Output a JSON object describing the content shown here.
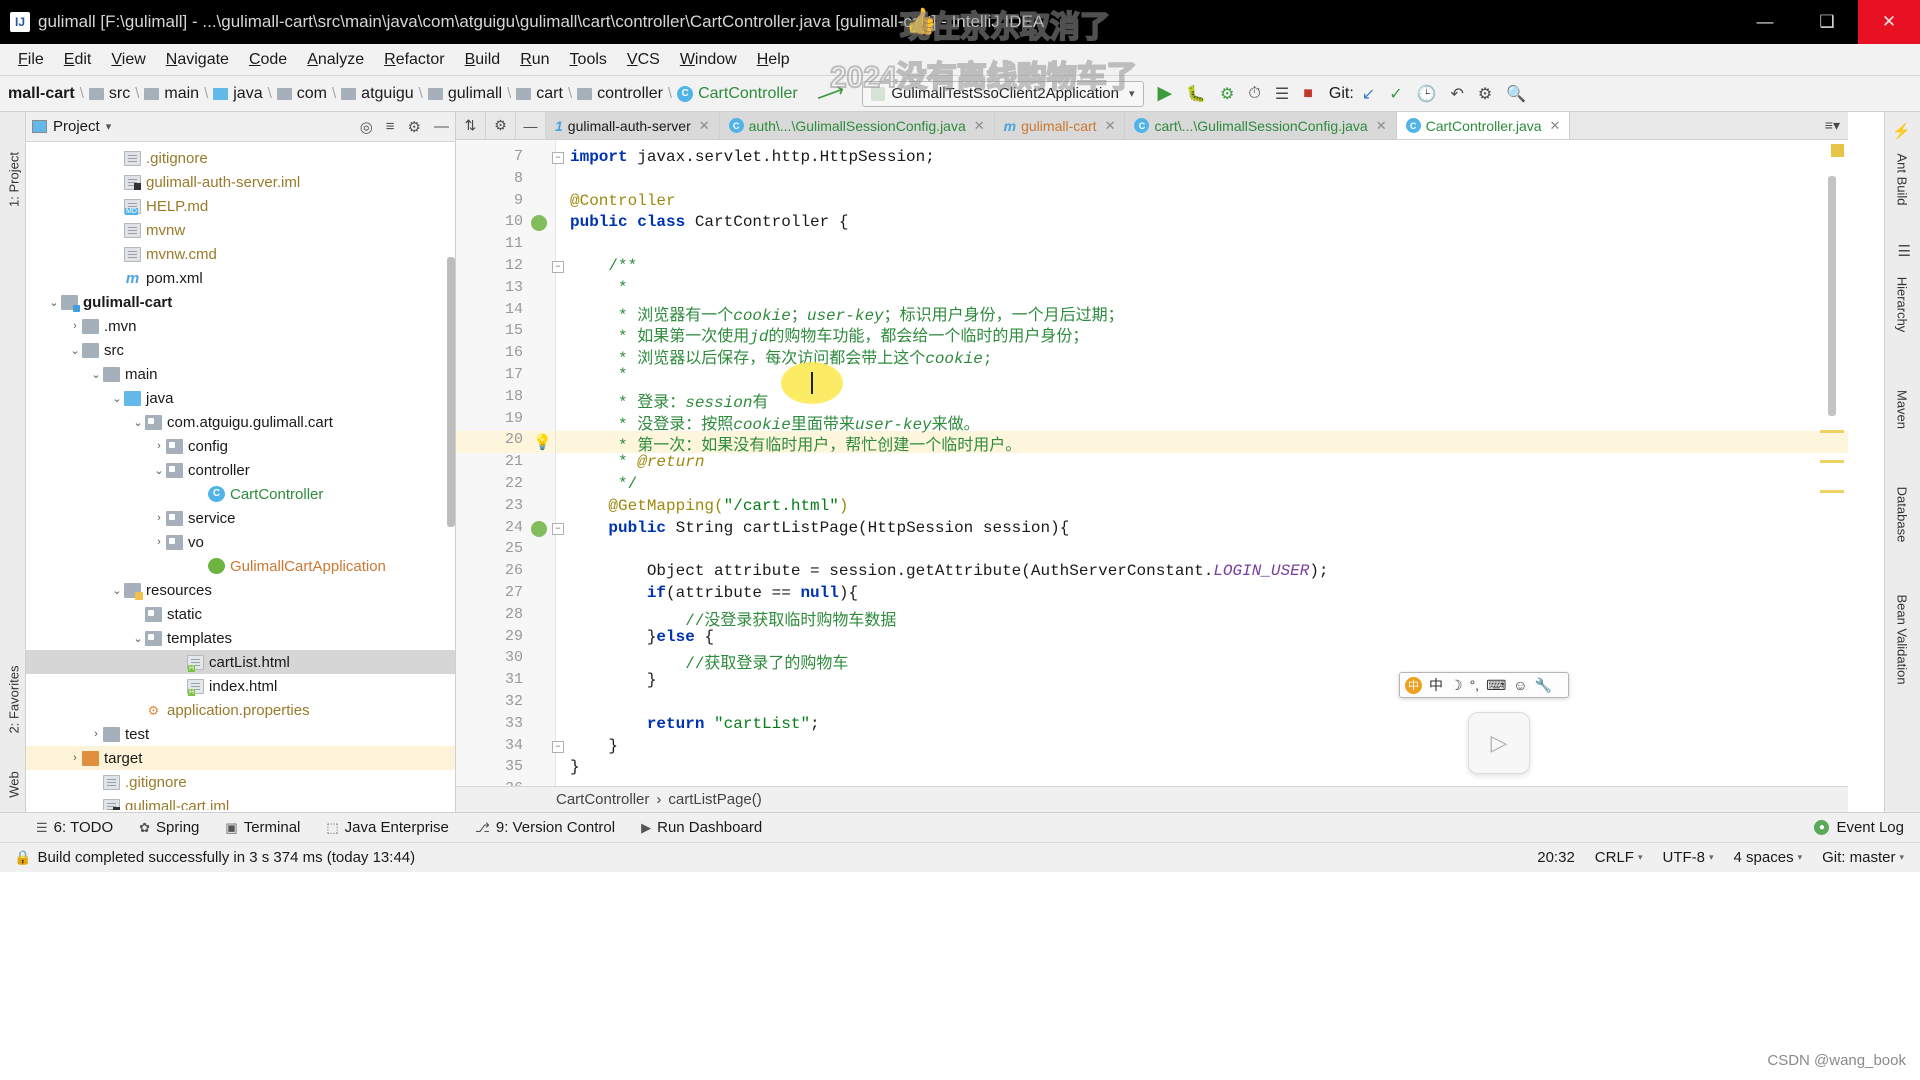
{
  "window": {
    "title": "gulimall [F:\\gulimall] - ...\\gulimall-cart\\src\\main\\java\\com\\atguigu\\gulimall\\cart\\controller\\CartController.java [gulimall-cart] - IntelliJ IDEA",
    "app_icon": "intellij-idea-icon",
    "minimize": "—",
    "maximize": "❑",
    "close": "✕"
  },
  "watermark": {
    "line1": "现在京东取消了",
    "line2": "2024没有离线购物车了",
    "thumb": "👍",
    "credit": "CSDN @wang_book"
  },
  "menubar": [
    "File",
    "Edit",
    "View",
    "Navigate",
    "Code",
    "Analyze",
    "Refactor",
    "Build",
    "Run",
    "Tools",
    "VCS",
    "Window",
    "Help"
  ],
  "breadcrumb": [
    {
      "label": "mall-cart",
      "icon": "module-icon",
      "bold": true
    },
    {
      "label": "src",
      "icon": "folder-icon"
    },
    {
      "label": "main",
      "icon": "folder-icon"
    },
    {
      "label": "java",
      "icon": "source-folder-icon"
    },
    {
      "label": "com",
      "icon": "folder-icon"
    },
    {
      "label": "atguigu",
      "icon": "folder-icon"
    },
    {
      "label": "gulimall",
      "icon": "folder-icon"
    },
    {
      "label": "cart",
      "icon": "folder-icon"
    },
    {
      "label": "controller",
      "icon": "folder-icon"
    },
    {
      "label": "CartController",
      "icon": "class-icon"
    }
  ],
  "toolbar": {
    "back_arrow_icon": "back-arrow-icon",
    "run_config": "GulimallTestSsoClient2Application",
    "run_config_caret": "▾",
    "icons": [
      "run-icon",
      "debug-icon",
      "run-with-coverage-icon",
      "profiler-icon",
      "build-icon",
      "stop-icon"
    ],
    "git_label": "Git:",
    "git_icons": [
      "update-project-icon",
      "commit-icon",
      "history-icon",
      "rollback-icon",
      "settings-icon",
      "search-everywhere-icon"
    ]
  },
  "left_strip": [
    "1: Project",
    "2: Favorites",
    "Web"
  ],
  "project_panel": {
    "title": "Project",
    "title_caret": "▾",
    "header_icons": [
      "locate-icon",
      "collapse-all-icon",
      "settings-icon",
      "hide-icon"
    ],
    "tree": [
      {
        "indent": 4,
        "arrow": "",
        "icon": "file-icon",
        "label": ".gitignore",
        "style": "amberTxt"
      },
      {
        "indent": 4,
        "arrow": "",
        "icon": "iml-file-icon",
        "label": "gulimall-auth-server.iml",
        "style": "amberTxt"
      },
      {
        "indent": 4,
        "arrow": "",
        "icon": "markdown-file-icon",
        "label": "HELP.md",
        "style": "amberTxt"
      },
      {
        "indent": 4,
        "arrow": "",
        "icon": "file-icon",
        "label": "mvnw",
        "style": "amberTxt"
      },
      {
        "indent": 4,
        "arrow": "",
        "icon": "file-icon",
        "label": "mvnw.cmd",
        "style": "amberTxt"
      },
      {
        "indent": 4,
        "arrow": "",
        "icon": "maven-file-icon",
        "label": "pom.xml",
        "style": "plain"
      },
      {
        "indent": 1,
        "arrow": "⌄",
        "icon": "module-folder-icon",
        "label": "gulimall-cart",
        "style": "bold"
      },
      {
        "indent": 2,
        "arrow": "›",
        "icon": "folder-icon",
        "label": ".mvn",
        "style": "plain"
      },
      {
        "indent": 2,
        "arrow": "⌄",
        "icon": "folder-icon",
        "label": "src",
        "style": "plain"
      },
      {
        "indent": 3,
        "arrow": "⌄",
        "icon": "folder-icon",
        "label": "main",
        "style": "plain"
      },
      {
        "indent": 4,
        "arrow": "⌄",
        "icon": "source-folder-icon",
        "label": "java",
        "style": "plain"
      },
      {
        "indent": 5,
        "arrow": "⌄",
        "icon": "package-icon",
        "label": "com.atguigu.gulimall.cart",
        "style": "plain"
      },
      {
        "indent": 6,
        "arrow": "›",
        "icon": "package-icon",
        "label": "config",
        "style": "plain"
      },
      {
        "indent": 6,
        "arrow": "⌄",
        "icon": "package-icon",
        "label": "controller",
        "style": "plain"
      },
      {
        "indent": 8,
        "arrow": "",
        "icon": "class-icon",
        "label": "CartController",
        "style": "green"
      },
      {
        "indent": 6,
        "arrow": "›",
        "icon": "package-icon",
        "label": "service",
        "style": "plain"
      },
      {
        "indent": 6,
        "arrow": "›",
        "icon": "package-icon",
        "label": "vo",
        "style": "plain"
      },
      {
        "indent": 8,
        "arrow": "",
        "icon": "spring-class-icon",
        "label": "GulimallCartApplication",
        "style": "orange"
      },
      {
        "indent": 4,
        "arrow": "⌄",
        "icon": "resources-folder-icon",
        "label": "resources",
        "style": "plain"
      },
      {
        "indent": 5,
        "arrow": "",
        "icon": "package-icon",
        "label": "static",
        "style": "plain"
      },
      {
        "indent": 5,
        "arrow": "⌄",
        "icon": "package-icon",
        "label": "templates",
        "style": "plain"
      },
      {
        "indent": 7,
        "arrow": "",
        "icon": "html-file-icon",
        "label": "cartList.html",
        "style": "plain",
        "selected": true
      },
      {
        "indent": 7,
        "arrow": "",
        "icon": "html-file-icon",
        "label": "index.html",
        "style": "plain"
      },
      {
        "indent": 5,
        "arrow": "",
        "icon": "properties-file-icon",
        "label": "application.properties",
        "style": "amberTxt"
      },
      {
        "indent": 3,
        "arrow": "›",
        "icon": "folder-icon",
        "label": "test",
        "style": "plain"
      },
      {
        "indent": 2,
        "arrow": "›",
        "icon": "target-folder-icon",
        "label": "target",
        "style": "plain",
        "highlight": true
      },
      {
        "indent": 3,
        "arrow": "",
        "icon": "file-icon",
        "label": ".gitignore",
        "style": "amberTxt"
      },
      {
        "indent": 3,
        "arrow": "",
        "icon": "iml-file-icon",
        "label": "gulimall-cart.iml",
        "style": "amberTxt"
      }
    ]
  },
  "editor_tabs": [
    {
      "label": "gulimall-auth-server",
      "icon": "module-icon",
      "icon_char": "1",
      "active": false
    },
    {
      "label": "auth\\...\\GulimallSessionConfig.java",
      "icon": "class-icon",
      "icon_char": "C",
      "active": false
    },
    {
      "label": "gulimall-cart",
      "icon": "maven-icon",
      "icon_char": "m",
      "active": false
    },
    {
      "label": "cart\\...\\GulimallSessionConfig.java",
      "icon": "class-icon",
      "icon_char": "C",
      "active": false
    },
    {
      "label": "CartController.java",
      "icon": "class-icon",
      "icon_char": "C",
      "active": true
    }
  ],
  "editor_tabs_menu": "≡▾",
  "code": {
    "first_line": 7,
    "lines": [
      {
        "n": 7,
        "html": "<span class=\"kw\">import</span><span class=\"plain\"> javax.servlet.http.HttpSession;</span>",
        "fold": true
      },
      {
        "n": 8,
        "html": ""
      },
      {
        "n": 9,
        "html": "<span class=\"ann\">@Controller</span>"
      },
      {
        "n": 10,
        "html": "<span class=\"kw\">public class</span><span class=\"plain\"> CartController {</span>",
        "gutter": "spring"
      },
      {
        "n": 11,
        "html": ""
      },
      {
        "n": 12,
        "html": "<span class=\"cmt\">    /**</span>",
        "fold": true
      },
      {
        "n": 13,
        "html": "<span class=\"cmt\">     *</span>"
      },
      {
        "n": 14,
        "html": "<span class=\"cmt\">     * 浏览器有一个<i>cookie</i>；<i>user-key</i>；标识用户身份，一个月后过期；</span>"
      },
      {
        "n": 15,
        "html": "<span class=\"cmt\">     * 如果第一次使用<i>jd</i>的购物车功能，都会给一个临时的用户身份；</span>"
      },
      {
        "n": 16,
        "html": "<span class=\"cmt\">     * 浏览器以后保存，每次访问都会带上这个<i>cookie</i>;</span>"
      },
      {
        "n": 17,
        "html": "<span class=\"cmt\">     *</span>"
      },
      {
        "n": 18,
        "html": "<span class=\"cmt\">     * 登录：<i>session</i>有</span>"
      },
      {
        "n": 19,
        "html": "<span class=\"cmt\">     * 没登录：按照<i>cookie</i>里面带来<i>user-key</i>来做。</span>"
      },
      {
        "n": 20,
        "html": "<span class=\"cmt\">     * 第一次：如果没有临时用户，帮忙创建一个临时用户。</span>",
        "highlight": true,
        "gutter": "bulb"
      },
      {
        "n": 21,
        "html": "<span class=\"cmt\">     * </span><span class=\"ann\"><i>@return</i></span>"
      },
      {
        "n": 22,
        "html": "<span class=\"cmt\">     */</span>"
      },
      {
        "n": 23,
        "html": "<span class=\"ann\">    @GetMapping(</span><span class=\"str\">\"/cart.html\"</span><span class=\"ann\">)</span>"
      },
      {
        "n": 24,
        "html": "<span class=\"kw\">    public </span><span class=\"plain\">String cartListPage(HttpSession session){</span>",
        "gutter": "spring-at",
        "fold": true
      },
      {
        "n": 25,
        "html": ""
      },
      {
        "n": 26,
        "html": "<span class=\"plain\">        Object attribute = session.getAttribute(AuthServerConstant.</span><span class=\"cst\">LOGIN_USER</span><span class=\"plain\">);</span>"
      },
      {
        "n": 27,
        "html": "<span class=\"kw\">        if</span><span class=\"plain\">(attribute == </span><span class=\"kw\">null</span><span class=\"plain\">){</span>"
      },
      {
        "n": 28,
        "html": "<span class=\"cmt\">            //没登录获取临时购物车数据</span>"
      },
      {
        "n": 29,
        "html": "<span class=\"plain\">        }</span><span class=\"kw\">else </span><span class=\"plain\">{</span>"
      },
      {
        "n": 30,
        "html": "<span class=\"cmt\">            //获取登录了的购物车</span>"
      },
      {
        "n": 31,
        "html": "<span class=\"plain\">        }</span>"
      },
      {
        "n": 32,
        "html": ""
      },
      {
        "n": 33,
        "html": "<span class=\"kw\">        return </span><span class=\"str\">\"cartList\"</span><span class=\"plain\">;</span>"
      },
      {
        "n": 34,
        "html": "<span class=\"plain\">    }</span>",
        "fold": true
      },
      {
        "n": 35,
        "html": "<span class=\"plain\">}</span>"
      },
      {
        "n": 36,
        "html": ""
      }
    ]
  },
  "editor_breadcrumb": [
    "CartController",
    "cartListPage()"
  ],
  "editor_breadcrumb_sep": "›",
  "right_strip": [
    "Ant Build",
    "Hierarchy",
    "Maven",
    "Database",
    "Bean Validation"
  ],
  "ime_toolbar": {
    "logo": "Ⓤ",
    "mode": "中",
    "moon": "☽",
    "punct": "°,",
    "keyboard": "⌨",
    "user": "☺",
    "tools": "🔧"
  },
  "float_button": "▷",
  "bottom_bar": {
    "items": [
      {
        "label": "6: TODO",
        "icon": "todo-icon"
      },
      {
        "label": "Spring",
        "icon": "spring-icon"
      },
      {
        "label": "Terminal",
        "icon": "terminal-icon"
      },
      {
        "label": "Java Enterprise",
        "icon": "java-enterprise-icon"
      },
      {
        "label": "9: Version Control",
        "icon": "version-control-icon"
      },
      {
        "label": "Run Dashboard",
        "icon": "run-dashboard-icon"
      }
    ],
    "event_log": "Event Log",
    "event_log_icon": "event-log-icon"
  },
  "status_bar": {
    "message": "Build completed successfully in 3 s 374 ms (today 13:44)",
    "caret_position": "20:32",
    "line_separator": "CRLF",
    "encoding": "UTF-8",
    "indent": "4 spaces",
    "branch": "Git: master",
    "lock_icon": "lock-icon",
    "caret": "⌄"
  }
}
